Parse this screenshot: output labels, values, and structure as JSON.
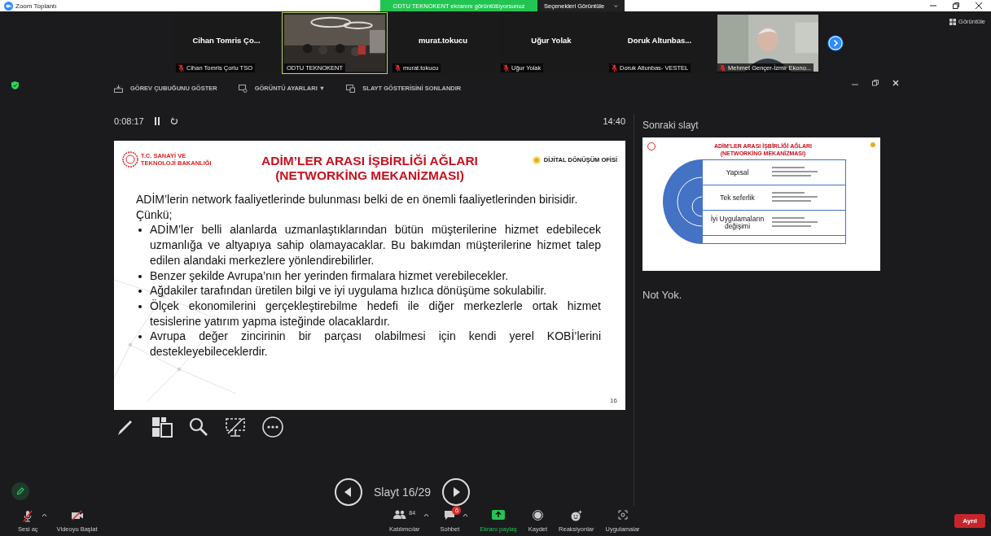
{
  "window": {
    "title": "Zoom Toplantı"
  },
  "share_banner": {
    "text": "ODTU TEKNOKENT ekranını görüntülüyorsunuz",
    "options": "Seçenekleri Görüntüle"
  },
  "participants": [
    {
      "kind": "name",
      "display": "Cihan Tomris Ço...",
      "label": "Cihan Tomris Çorlu TSO",
      "muted": true,
      "speaking": false
    },
    {
      "kind": "video",
      "label": "ODTU TEKNOKENT",
      "muted": false,
      "speaking": true
    },
    {
      "kind": "name",
      "display": "murat.tokucu",
      "label": "murat.tokucu",
      "muted": true,
      "speaking": false
    },
    {
      "kind": "name",
      "display": "Uğur Yolak",
      "label": "Uğur Yolak",
      "muted": true,
      "speaking": false
    },
    {
      "kind": "name",
      "display": "Doruk  Altunbas...",
      "label": "Doruk Altunbas- VESTEL",
      "muted": true,
      "speaking": false
    },
    {
      "kind": "video",
      "label": "Mehmet Gençer-İzmir Ekono...",
      "muted": true,
      "speaking": false
    }
  ],
  "view_button": "Görüntüle",
  "presenter_toolbar": [
    "GÖREV ÇUBUĞUNU GÖSTER",
    "GÖRÜNTÜ AYARLARI ▼",
    "SLAYT GÖSTERİSİNİ SONLANDIR"
  ],
  "timer": "0:08:17",
  "clock": "14:40",
  "slide": {
    "logo_left": "T.C. SANAYİ VE TEKNOLOJİ BAKANLIĞI",
    "logo_right": "DİJİTAL DÖNÜŞÜM OFİSİ",
    "title": [
      "ADİM’LER ARASI İŞBİRLİĞİ AĞLARI",
      "(NETWORKİNG MEKANİZMASI)"
    ],
    "intro": [
      "ADİM’lerin network faaliyetlerinde bulunması belki de en önemli faaliyetlerinden birisidir.",
      "Çünkü;"
    ],
    "bullets": [
      "ADİM’ler belli alanlarda uzmanlaştıklarından bütün müşterilerine hizmet edebilecek uzmanlığa ve altyapıya sahip olamayacaklar. Bu bakımdan müşterilerine hizmet talep edilen alandaki merkezlere yönlendirebilirler.",
      "Benzer şekilde Avrupa’nın her yerinden firmalara hizmet verebilecekler.",
      "Ağdakiler tarafından üretilen bilgi ve iyi uygulama hızlıca dönüşüme sokulabilir.",
      "Ölçek ekonomilerini gerçekleştirebilme hedefi ile diğer merkezlerle ortak hizmet tesislerine yatırım yapma isteğinde olacaklardır.",
      "Avrupa değer zincirinin bir parçası olabilmesi için kendi yerel KOBİ’lerini destekleyebileceklerdir."
    ],
    "number": "16"
  },
  "next_slide": {
    "heading": "Sonraki slayt",
    "title": [
      "ADİM’LER ARASI İŞBİRLİĞİ AĞLARI",
      "(NETWORKİNG MEKANİZMASI)"
    ],
    "rows": [
      "Yapısal",
      "Tek seferlik",
      "İyi Uygulamaların değişimi"
    ]
  },
  "notes": "Not Yok.",
  "slide_nav": "Slayt 16/29",
  "controls": [
    {
      "kind": "mic",
      "label": "Sesi aç",
      "caret": true
    },
    {
      "kind": "video",
      "label": "Videoyu Başlat",
      "caret": false
    },
    {
      "kind": "participants",
      "label": "Katılımcılar",
      "count": "84",
      "caret": true
    },
    {
      "kind": "chat",
      "label": "Sohbet",
      "badge": "6",
      "caret": true
    },
    {
      "kind": "share",
      "label": "Ekranı paylaş",
      "caret": false
    },
    {
      "kind": "record",
      "label": "Kaydet",
      "caret": false
    },
    {
      "kind": "reactions",
      "label": "Reaksiyonlar",
      "caret": false
    },
    {
      "kind": "apps",
      "label": "Uygulamalar",
      "caret": false
    }
  ],
  "leave": "Ayrıl"
}
